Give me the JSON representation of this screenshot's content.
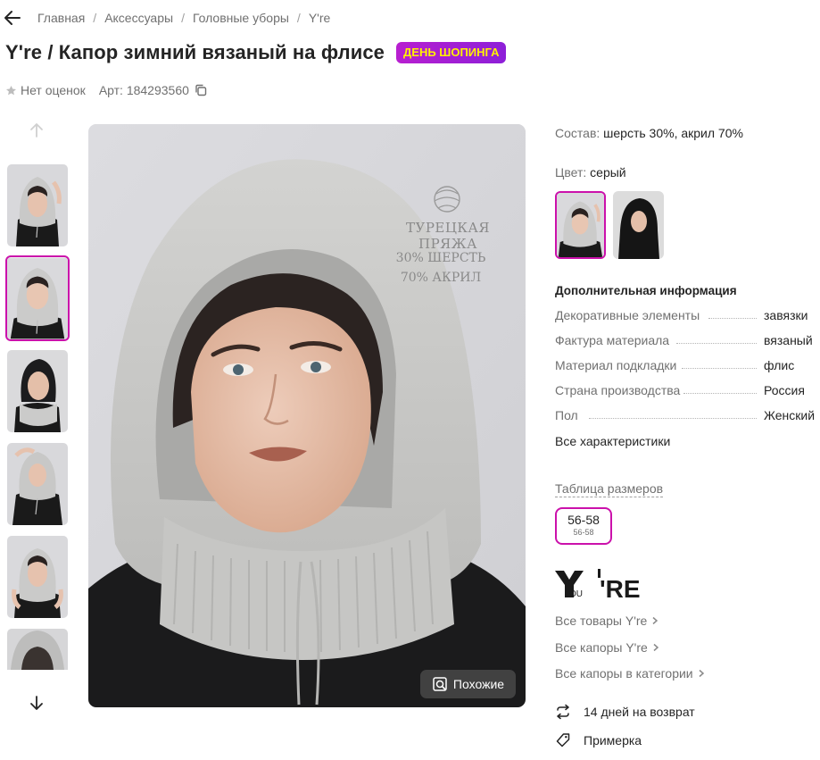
{
  "breadcrumb": [
    "Главная",
    "Аксессуары",
    "Головные уборы",
    "Y're"
  ],
  "product": {
    "title": "Y're / Капор зимний вязаный на флисе",
    "promo_badge": "ДЕНЬ ШОПИНГА",
    "rating_text": "Нет оценок",
    "article_label": "Арт:",
    "article_value": "184293560"
  },
  "photo": {
    "overlay_title": "ТУРЕЦКАЯ ПРЯЖА",
    "overlay_line1": "30% ШЕРСТЬ",
    "overlay_line2": "70% АКРИЛ",
    "similar_button": "Похожие"
  },
  "thumbnails": [
    {
      "name": "thumb-1",
      "active": false
    },
    {
      "name": "thumb-2",
      "active": true
    },
    {
      "name": "thumb-3",
      "active": false
    },
    {
      "name": "thumb-4",
      "active": false
    },
    {
      "name": "thumb-5",
      "active": false
    },
    {
      "name": "thumb-6",
      "active": false
    }
  ],
  "composition": {
    "label": "Состав:",
    "value": "шерсть 30%, акрил 70%"
  },
  "color": {
    "label": "Цвет:",
    "value": "серый"
  },
  "additional_info": {
    "title": "Дополнительная информация",
    "specs": [
      {
        "key": "Декоративные элементы",
        "value": "завязки"
      },
      {
        "key": "Фактура материала",
        "value": "вязаный"
      },
      {
        "key": "Материал подкладки",
        "value": "флис"
      },
      {
        "key": "Страна производства",
        "value": "Россия"
      },
      {
        "key": "Пол",
        "value": "Женский"
      }
    ],
    "all_link": "Все характеристики"
  },
  "sizes": {
    "table_link": "Таблица размеров",
    "selected": {
      "label": "56-58",
      "sub": "56-58"
    }
  },
  "brand": {
    "logo_text": "Y'RE",
    "logo_small": "OU"
  },
  "links": [
    "Все товары Y're",
    "Все капоры Y're",
    "Все капоры в категории"
  ],
  "features": [
    "14 дней на возврат",
    "Примерка"
  ],
  "colors": {
    "accent": "#cb11ab",
    "badge_text": "#fff200",
    "text": "#242424",
    "muted": "#707070"
  }
}
